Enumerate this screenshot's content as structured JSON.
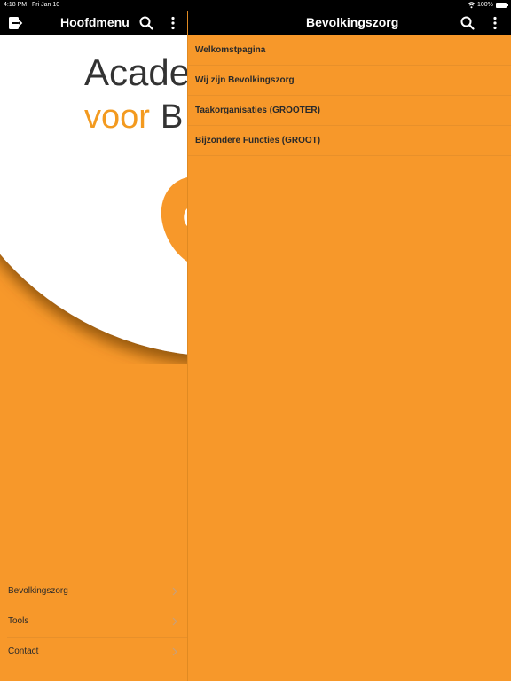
{
  "status": {
    "time": "4:18 PM",
    "date": "Fri Jan 10",
    "battery": "100%"
  },
  "left": {
    "title": "Hoofdmenu",
    "logo_line1": "Acade",
    "logo_line2_a": "voor",
    "logo_line2_b": "B",
    "menu": [
      {
        "label": "Bevolkingszorg"
      },
      {
        "label": "Tools"
      },
      {
        "label": "Contact"
      }
    ]
  },
  "right": {
    "title": "Bevolkingszorg",
    "items": [
      {
        "label": "Welkomstpagina"
      },
      {
        "label": "Wij zijn Bevolkingszorg"
      },
      {
        "label": "Taakorganisaties (GROOTER)"
      },
      {
        "label": "Bijzondere Functies (GROOT)"
      }
    ]
  },
  "colors": {
    "accent": "#f7982a",
    "bar": "#000000",
    "text": "#2a2a2a"
  }
}
